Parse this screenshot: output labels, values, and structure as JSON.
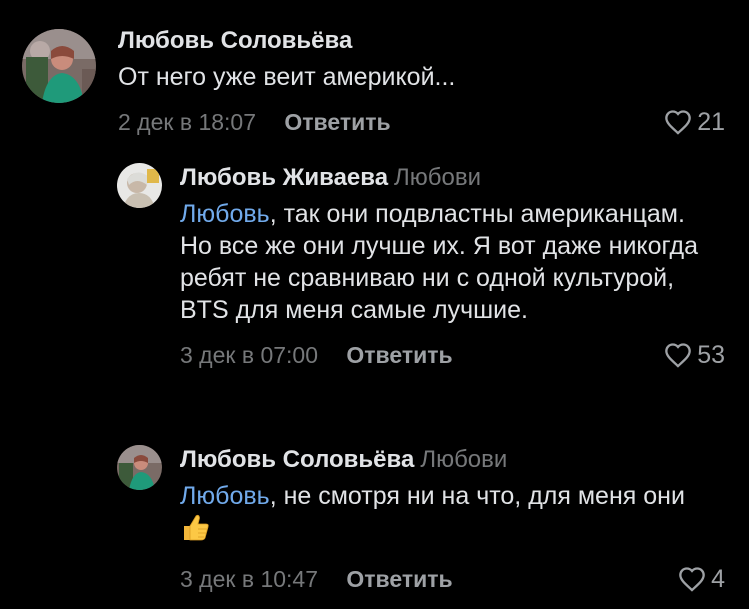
{
  "comments": [
    {
      "author": "Любовь Соловьёва",
      "reply_to": "",
      "mention": "",
      "text": "От него уже веит америкой...",
      "date": "2 дек в 18:07",
      "reply_label": "Ответить",
      "likes": "21"
    },
    {
      "author": "Любовь Живаева",
      "reply_to": "Любови",
      "mention": "Любовь",
      "text": ", так они подвластны американцам. Но все же они лучше их. Я вот даже никогда ребят не сравниваю ни с одной культурой, BTS для меня самые лучшие.",
      "date": "3 дек в 07:00",
      "reply_label": "Ответить",
      "likes": "53"
    },
    {
      "author": "Любовь Соловьёва",
      "reply_to": "Любови",
      "mention": "Любовь",
      "text": ", не смотря ни на что, для меня они",
      "emoji": "thumbs-up-emoji",
      "date": "3 дек в 10:47",
      "reply_label": "Ответить",
      "likes": "4"
    }
  ],
  "colors": {
    "background": "#000000",
    "text": "#e1e3e6",
    "muted": "#76787a",
    "link": "#71aaeb",
    "action": "#9ea1a5"
  }
}
